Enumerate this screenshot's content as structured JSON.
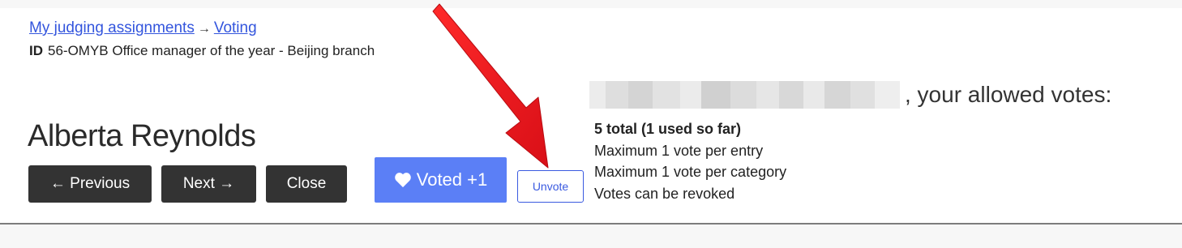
{
  "breadcrumb": {
    "items": [
      {
        "label": "My judging assignments"
      },
      {
        "label": "Voting"
      }
    ],
    "separator": "→"
  },
  "entry": {
    "id_label": "ID",
    "id_text": "56-OMYB Office manager of the year - Beijing branch",
    "name": "Alberta Reynolds"
  },
  "navigation": {
    "previous_label": "← Previous",
    "next_label": "Next →",
    "close_label": "Close"
  },
  "vote": {
    "voted_label": "Voted +1",
    "unvote_label": "Unvote",
    "icon": "heart-icon",
    "accent_color": "#5b7ff6"
  },
  "allowed_votes": {
    "heading_suffix": ", your allowed votes:",
    "rules": [
      "5 total (1 used so far)",
      "Maximum 1 vote per entry",
      "Maximum 1 vote per category",
      "Votes can be revoked"
    ]
  },
  "annotation": {
    "arrow_color": "#e8141c"
  }
}
